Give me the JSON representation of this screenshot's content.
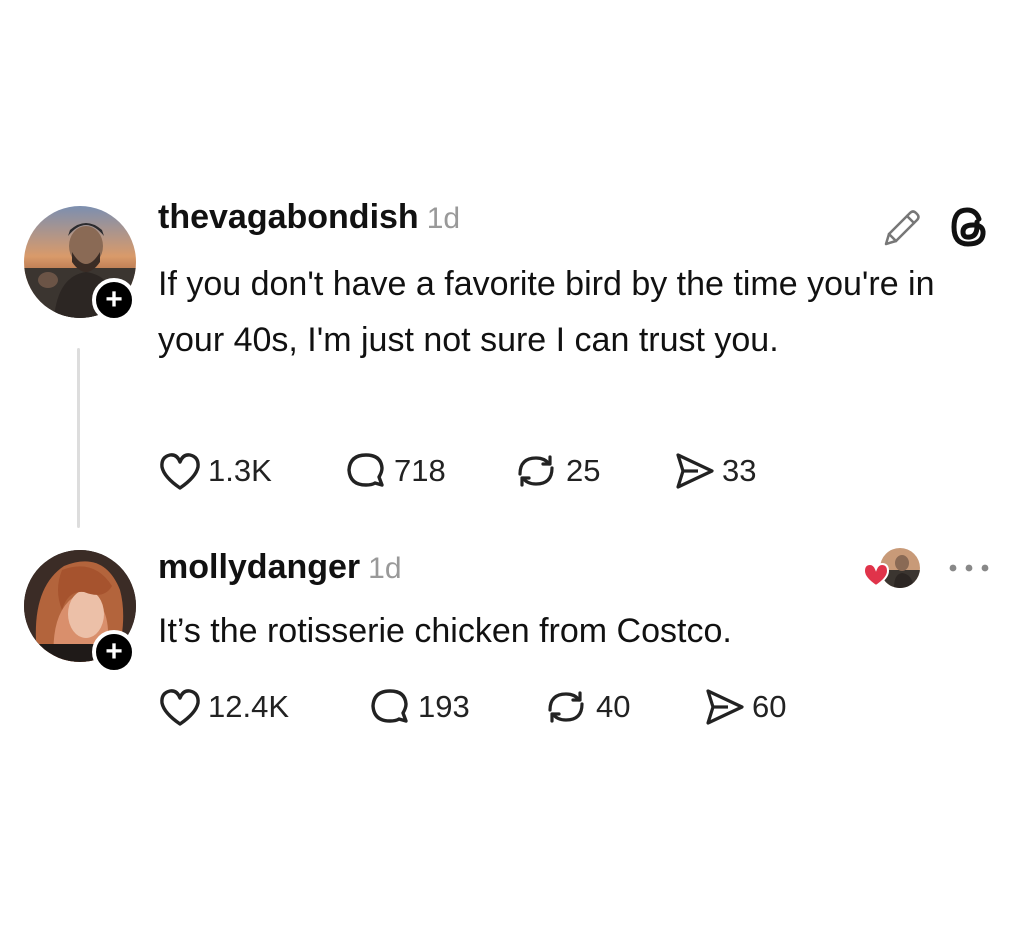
{
  "thread": {
    "post": {
      "username": "thevagabondish",
      "timestamp": "1d",
      "text": "If you don't have a favorite bird by the time you're in your 40s, I'm just not sure I can trust you.",
      "likes": "1.3K",
      "replies": "718",
      "reposts": "25",
      "shares": "33",
      "icons": [
        "edit-icon",
        "threads-logo-icon"
      ]
    },
    "reply": {
      "username": "mollydanger",
      "timestamp": "1d",
      "text": "It’s the rotisserie chicken from Costco.",
      "likes": "12.4K",
      "replies": "193",
      "reposts": "40",
      "shares": "60",
      "icons": [
        "liked-by-author-icon",
        "more-icon"
      ]
    }
  },
  "follow_badge_symbol": "+",
  "colors": {
    "text": "#111111",
    "muted": "#999999",
    "heart_red": "#e0334a",
    "thread_line": "#dddddd"
  }
}
